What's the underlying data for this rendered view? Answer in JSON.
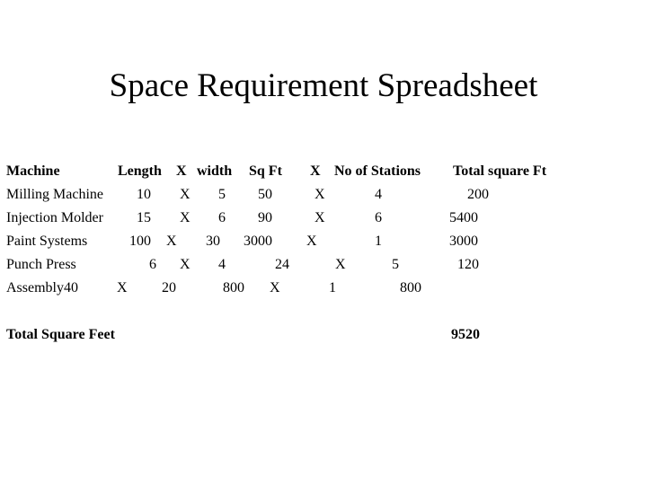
{
  "slide": {
    "title": "Space Requirement Spreadsheet",
    "background_color": "#ffffff",
    "text_color": "#000000"
  },
  "table": {
    "header": {
      "machine": "Machine",
      "length": "Length",
      "times_1": "X",
      "width": "width",
      "sq_ft": "Sq Ft",
      "times_2": "X",
      "no_of_stations": "No of Stations",
      "total_square_ft": "Total square Ft"
    },
    "rows": [
      {
        "machine": "Milling Machine",
        "length": "10",
        "times_1": "X",
        "width": "5",
        "sq_ft": "50",
        "times_2": "X",
        "stations": "4",
        "total": "200"
      },
      {
        "machine": "Injection Molder",
        "length": "15",
        "times_1": "X",
        "width": "6",
        "sq_ft": "90",
        "times_2": "X",
        "stations": "6",
        "total": "5400"
      },
      {
        "machine": "Paint Systems",
        "length": "100",
        "times_1": "X",
        "width": "30",
        "sq_ft": "3000",
        "times_2": "X",
        "stations": "1",
        "total": "3000"
      },
      {
        "machine": "Punch Press",
        "length": "6",
        "times_1": "X",
        "width": "4",
        "sq_ft": "24",
        "times_2": "X",
        "stations": "5",
        "total": "120"
      },
      {
        "machine": "Assembly40",
        "length": "",
        "times_1": "X",
        "width": "20",
        "sq_ft": "800",
        "times_2": "X",
        "stations": "1",
        "total": "800"
      }
    ],
    "total_row": {
      "label": "Total Square Feet",
      "value": "9520"
    }
  }
}
